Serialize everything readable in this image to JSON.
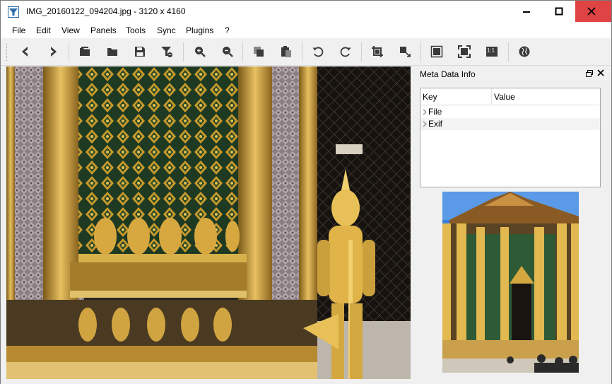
{
  "window": {
    "title": "IMG_20160122_094204.jpg  - 3120 x 4160",
    "accent_close": "#e04343"
  },
  "menu": {
    "items": [
      "File",
      "Edit",
      "View",
      "Panels",
      "Tools",
      "Sync",
      "Plugins",
      "?"
    ]
  },
  "toolbar": {
    "buttons": [
      "back-icon",
      "forward-icon",
      "open-folder-icon",
      "folder-icon",
      "save-icon",
      "filter-icon",
      "zoom-in-icon",
      "zoom-out-icon",
      "copy-icon",
      "paste-icon",
      "rotate-left-icon",
      "rotate-right-icon",
      "crop-icon",
      "resize-icon",
      "fit-window-icon",
      "fullscreen-icon",
      "actual-size-icon",
      "globe-icon"
    ],
    "actual_size_label": "1:1"
  },
  "panel": {
    "title": "Meta Data Info",
    "table": {
      "headers": [
        "Key",
        "Value"
      ],
      "rows": [
        {
          "key": "File",
          "value": ""
        },
        {
          "key": "Exif",
          "value": ""
        }
      ]
    }
  }
}
